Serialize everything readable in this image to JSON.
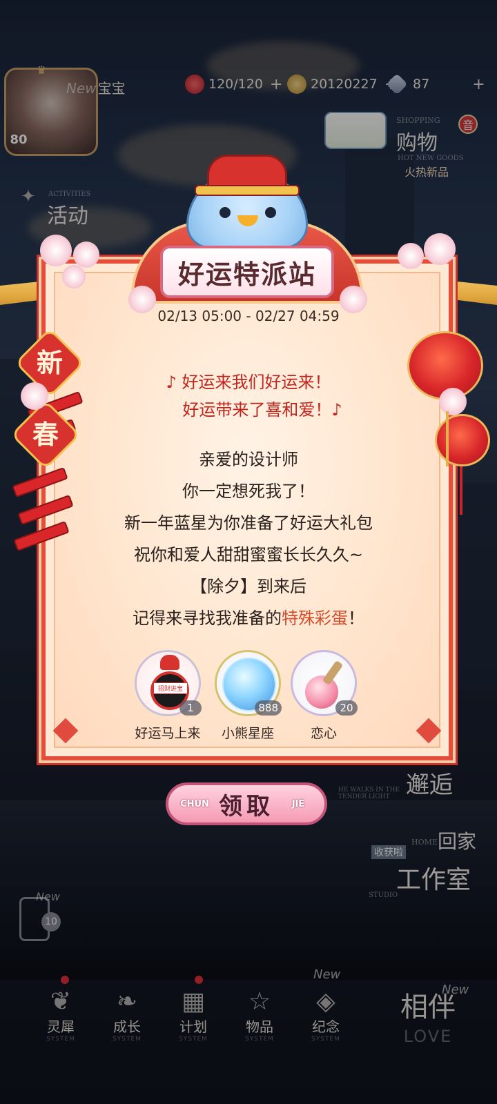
{
  "hud": {
    "avatar_level": "80",
    "name_prefix": "New",
    "name": "宝宝",
    "stamina": "120/120",
    "coins": "20120227",
    "gems": "87",
    "plus": "+"
  },
  "right_menu": {
    "shop_en": "SHOPPING",
    "shop_label": "购物",
    "shop_badge": "音",
    "new_goods_en": "HOT NEW GOODS",
    "new_goods": "火热新品",
    "encounter": "邂逅",
    "encounter_sub": "HE WALKS IN THE TENDER LIGHT",
    "home": "回家",
    "home_en": "HOME",
    "studio": "工作室",
    "studio_tag": "收获啦",
    "studio_en": "STUDIO"
  },
  "left_menu": {
    "activities_en": "ACTIVITIES",
    "activities": "活动",
    "new_tag": "New",
    "phone_count": "10"
  },
  "popup": {
    "title": "好运特派站",
    "date_range": "02/13 05:00 - 02/27 04:59",
    "song_line1": "♪ 好运来我们好运来！",
    "song_line2": "好运带来了喜和爱！♪",
    "message_lines": [
      "亲爱的设计师",
      "你一定想死我了！",
      "新一年蓝星为你准备了好运大礼包",
      "祝你和爱人甜甜蜜蜜长长久久~",
      "【除夕】到来后"
    ],
    "last_line_prefix": "记得来寻找我准备的",
    "last_line_highlight": "特殊彩蛋",
    "last_line_suffix": "！",
    "seal_chars": [
      "新",
      "春"
    ],
    "rewards": [
      {
        "name": "好运马上来",
        "qty": "1",
        "badge": "招财进宝"
      },
      {
        "name": "小熊星座",
        "qty": "888"
      },
      {
        "name": "恋心",
        "qty": "20"
      }
    ],
    "claim_left": "CHUN",
    "claim_label": "领取",
    "claim_right": "JIE"
  },
  "bottom_nav": [
    {
      "label": "灵犀",
      "sub": "SYSTEM",
      "icon": "wings-icon"
    },
    {
      "label": "成长",
      "sub": "SYSTEM",
      "icon": "leaf-icon"
    },
    {
      "label": "计划",
      "sub": "SYSTEM",
      "icon": "calendar-icon"
    },
    {
      "label": "物品",
      "sub": "SYSTEM",
      "icon": "star-icon"
    },
    {
      "label": "纪念",
      "sub": "SYSTEM",
      "icon": "ring-icon",
      "tag": "New"
    },
    {
      "label": "相伴",
      "sub": "LOVE",
      "icon": "heart-icon",
      "tag": "New"
    }
  ],
  "colors": {
    "accent_red": "#e44e3a",
    "card_bg": "#ffe9d4",
    "highlight": "#d34a2c",
    "song_red": "#c0251e"
  }
}
